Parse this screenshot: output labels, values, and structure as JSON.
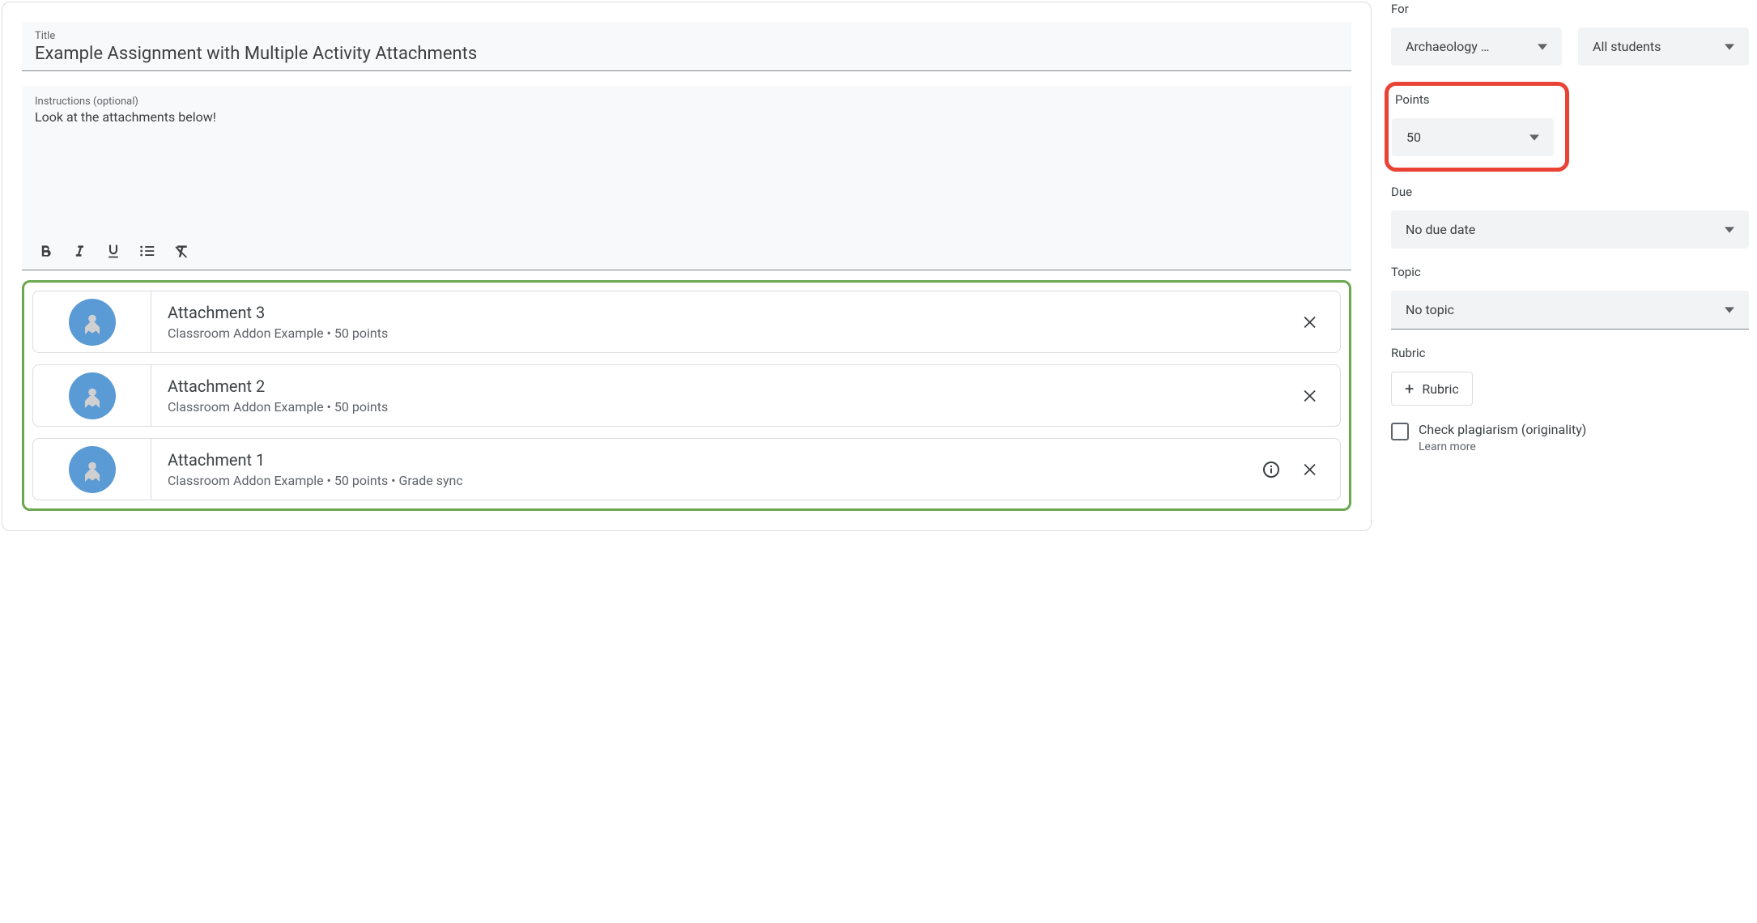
{
  "main": {
    "title_label": "Title",
    "title_value": "Example Assignment with Multiple Activity Attachments",
    "instructions_label": "Instructions (optional)",
    "instructions_value": "Look at the attachments below!",
    "attachments": [
      {
        "title": "Attachment 3",
        "subtitle": "Classroom Addon Example • 50 points",
        "has_info": false
      },
      {
        "title": "Attachment 2",
        "subtitle": "Classroom Addon Example • 50 points",
        "has_info": false
      },
      {
        "title": "Attachment 1",
        "subtitle": "Classroom Addon Example • 50 points • Grade sync",
        "has_info": true
      }
    ]
  },
  "sidebar": {
    "for_label": "For",
    "class_value": "Archaeology …",
    "students_value": "All students",
    "points_label": "Points",
    "points_value": "50",
    "due_label": "Due",
    "due_value": "No due date",
    "topic_label": "Topic",
    "topic_value": "No topic",
    "rubric_label": "Rubric",
    "rubric_button": "Rubric",
    "plagiarism_label": "Check plagiarism (originality)",
    "learn_more": "Learn more"
  }
}
